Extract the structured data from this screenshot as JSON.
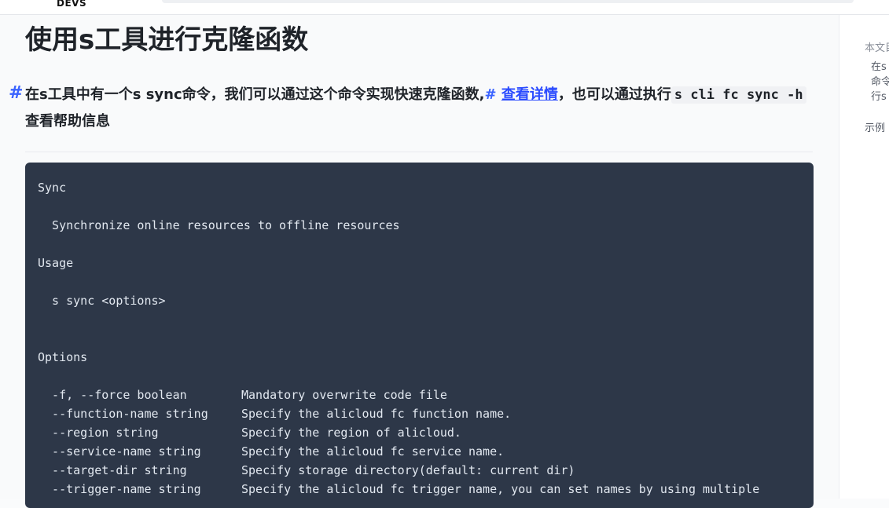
{
  "header": {
    "logo_text": "DEVS"
  },
  "article": {
    "title": "使用s工具进行克隆函数",
    "intro": {
      "anchor_symbol": "#",
      "text_before": "在s工具中有一个s sync命令，我们可以通过这个命令实现快速克隆函数,",
      "inline_hash": "#",
      "link_text": "查看详情",
      "text_middle": "，也可以通过执行",
      "code_text": "s cli fc sync -h",
      "text_after": "查看帮助信息"
    },
    "code_lines": [
      {
        "text": "Sync",
        "desc": ""
      },
      {
        "text": "  Synchronize online resources to offline resources",
        "desc": ""
      },
      {
        "text": "Usage",
        "desc": ""
      },
      {
        "text": "  s sync <options>",
        "desc": ""
      },
      {
        "text": "Options",
        "desc": ""
      },
      {
        "text": "  -f, --force boolean",
        "desc": "Mandatory overwrite code file"
      },
      {
        "text": "  --function-name string",
        "desc": "Specify the alicloud fc function name."
      },
      {
        "text": "  --region string",
        "desc": "Specify the region of alicloud."
      },
      {
        "text": "  --service-name string",
        "desc": "Specify the alicloud fc service name."
      },
      {
        "text": "  --target-dir string",
        "desc": "Specify storage directory(default: current dir)"
      },
      {
        "text": "  --trigger-name string",
        "desc": "Specify the alicloud fc trigger name, you can set names by using multiple"
      }
    ]
  },
  "toc": {
    "label": "本文目",
    "items": [
      "在s",
      "命令",
      "行s"
    ],
    "item2": "示例"
  }
}
